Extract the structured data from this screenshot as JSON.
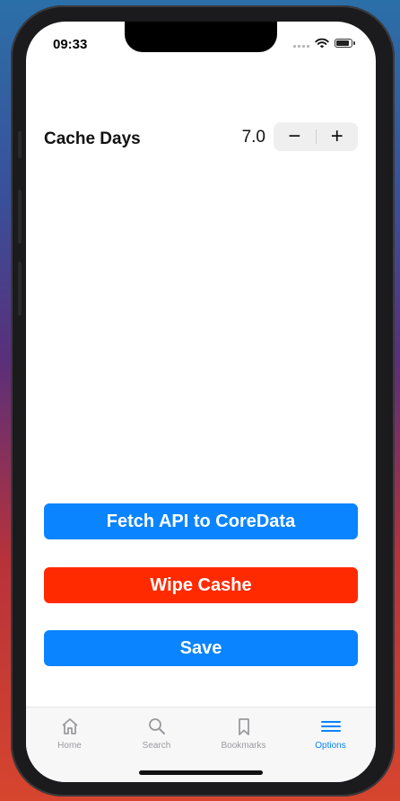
{
  "status_bar": {
    "time": "09:33"
  },
  "settings": {
    "cache_label": "Cache Days",
    "cache_value": "7.0",
    "decrement_symbol": "−",
    "increment_symbol": "+"
  },
  "actions": {
    "fetch_label": "Fetch API to CoreData",
    "wipe_label": "Wipe Cashe",
    "save_label": "Save"
  },
  "colors": {
    "accent": "#0a84ff",
    "destructive": "#ff2a00"
  },
  "tabbar": {
    "items": [
      {
        "label": "Home",
        "icon": "house-icon"
      },
      {
        "label": "Search",
        "icon": "magnifier-icon"
      },
      {
        "label": "Bookmarks",
        "icon": "bookmark-icon"
      },
      {
        "label": "Options",
        "icon": "hamburger-icon",
        "active": true
      }
    ]
  }
}
